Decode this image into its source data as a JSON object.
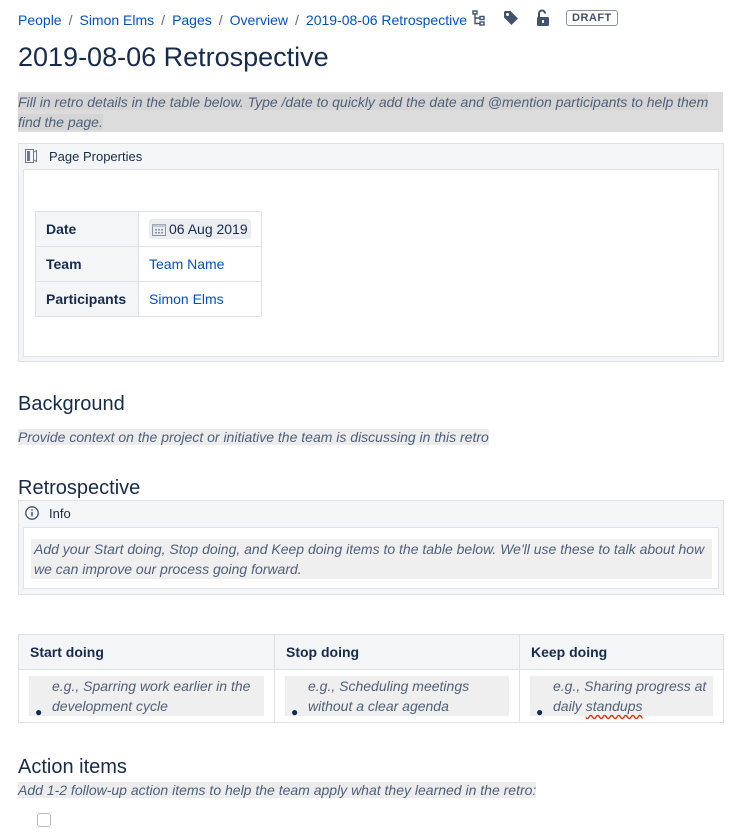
{
  "breadcrumb": {
    "items": [
      "People",
      "Simon Elms",
      "Pages",
      "Overview",
      "2019-08-06 Retrospective"
    ],
    "separator": "/",
    "draft_label": "DRAFT",
    "icons": [
      "page-tree-icon",
      "tag-icon",
      "unlock-icon"
    ]
  },
  "page": {
    "title": "2019-08-06 Retrospective",
    "intro": "Fill in retro details in the table below. Type /date to quickly add the date and @mention participants to help them find the page."
  },
  "page_properties": {
    "heading": "Page Properties",
    "rows": [
      {
        "key": "Date",
        "value": "06 Aug 2019"
      },
      {
        "key": "Team",
        "value": "Team Name"
      },
      {
        "key": "Participants",
        "value": "Simon Elms"
      }
    ]
  },
  "background": {
    "heading": "Background",
    "instruction": "Provide context on the project or initiative the team is discussing in this retro"
  },
  "retrospective": {
    "heading": "Retrospective",
    "info_heading": "Info",
    "info_text": "Add your Start doing, Stop doing, and Keep doing items to the table below. We'll use these to talk about how we can improve our process going forward.",
    "columns": [
      "Start doing",
      "Stop doing",
      "Keep doing"
    ],
    "cells": [
      {
        "line1": "e.g., Sparring work earlier in the",
        "line2": "development cycle"
      },
      {
        "line1": "e.g., Scheduling meetings",
        "line2": "without a clear agenda"
      },
      {
        "line1": "e.g., Sharing progress at",
        "line2_a": "daily ",
        "line2_b": "standups"
      }
    ]
  },
  "action_items": {
    "heading": "Action items",
    "instruction": "Add 1-2 follow-up action items to help the team apply what they learned in the retro:"
  },
  "colors": {
    "link": "#0052cc",
    "text": "#172b4d",
    "instruction_bg": "#dcdcdc",
    "border": "#dfe1e6"
  }
}
